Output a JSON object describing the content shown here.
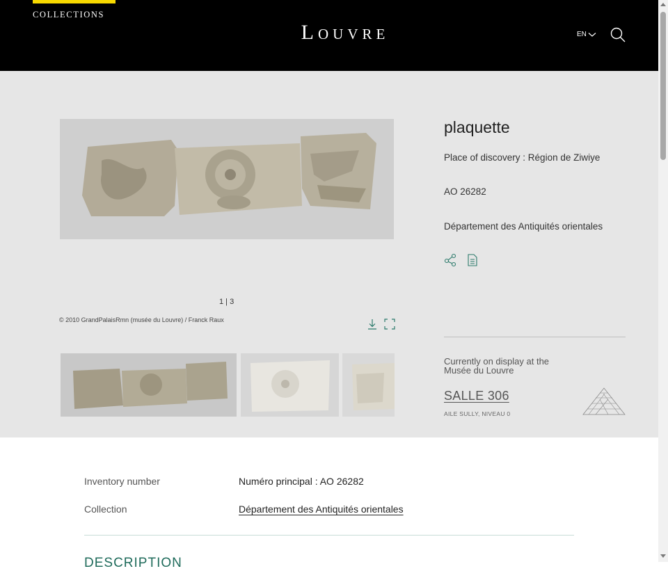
{
  "header": {
    "collections_label": "COLLECTIONS",
    "logo_text": "Louvre",
    "lang_label": "EN",
    "icons": [
      "chevron-down-icon",
      "search-icon"
    ],
    "colors": {
      "background": "#000000",
      "accent": "#f7d900"
    }
  },
  "artwork": {
    "title": "plaquette",
    "place": "Place of discovery : Région de Ziwiye",
    "inventory": "AO 26282",
    "department": "Département des Antiquités orientales",
    "actions": [
      "share-icon",
      "document-icon"
    ]
  },
  "gallery": {
    "counter": "1 | 3",
    "credit": "© 2010 GrandPalaisRmn (musée du Louvre) / Franck Raux",
    "actions": [
      "download-icon",
      "fullscreen-icon"
    ],
    "thumbnail_count": 3
  },
  "display": {
    "text": "Currently on display at the Musée du Louvre",
    "room": "SALLE 306",
    "wing": "AILE SULLY, NIVEAU 0"
  },
  "details": {
    "rows": [
      {
        "label": "Inventory number",
        "value": "Numéro principal : AO 26282"
      },
      {
        "label": "Collection",
        "value": "Département des Antiquités orientales"
      }
    ],
    "section_heading": "DESCRIPTION",
    "colors": {
      "heading": "#1f6b5b",
      "icons": "#2b7a6b"
    }
  }
}
